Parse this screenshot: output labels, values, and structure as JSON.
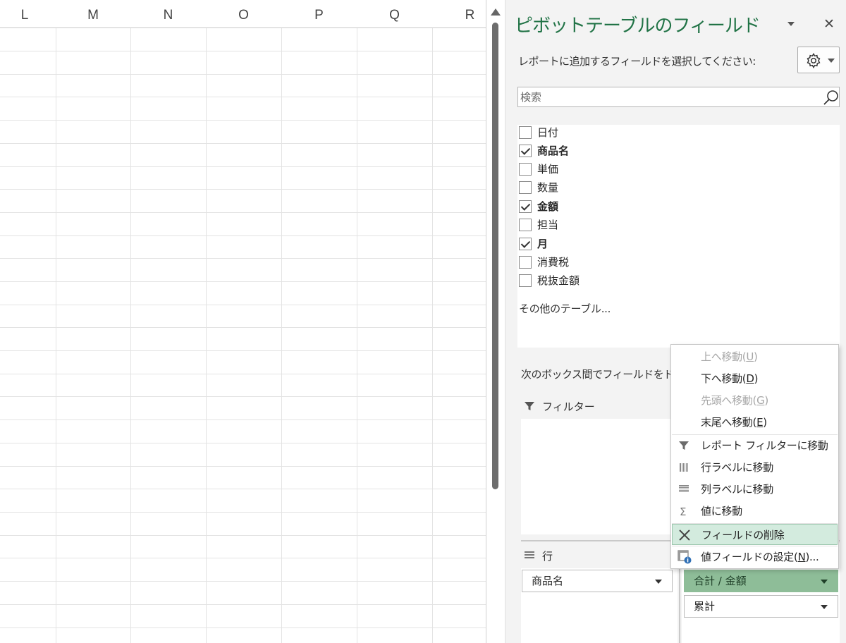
{
  "sheet": {
    "columns": [
      "L",
      "M",
      "N",
      "O",
      "P",
      "Q",
      "R"
    ]
  },
  "pane": {
    "title": "ピボットテーブルのフィールド",
    "instruction": "レポートに追加するフィールドを選択してください:",
    "search_placeholder": "検索",
    "fields": [
      {
        "label": "日付",
        "checked": false
      },
      {
        "label": "商品名",
        "checked": true
      },
      {
        "label": "単価",
        "checked": false
      },
      {
        "label": "数量",
        "checked": false
      },
      {
        "label": "金額",
        "checked": true
      },
      {
        "label": "担当",
        "checked": false
      },
      {
        "label": "月",
        "checked": true
      },
      {
        "label": "消費税",
        "checked": false
      },
      {
        "label": "税抜金額",
        "checked": false
      }
    ],
    "more_tables": "その他のテーブル...",
    "drag_instruction": "次のボックス間でフィールドをドラッ",
    "filter_label": "フィルター",
    "rows_label": "行",
    "rows_pills": [
      {
        "label": "商品名"
      }
    ],
    "values_pills": [
      {
        "label": "合計 / 金額"
      },
      {
        "label": "累計"
      }
    ]
  },
  "context_menu": {
    "items": [
      {
        "label": "上へ移動(",
        "key": "U",
        "suffix": ")",
        "disabled": true,
        "icon": ""
      },
      {
        "label": "下へ移動(",
        "key": "D",
        "suffix": ")",
        "disabled": false,
        "icon": ""
      },
      {
        "label": "先頭へ移動(",
        "key": "G",
        "suffix": ")",
        "disabled": true,
        "icon": ""
      },
      {
        "label": "末尾へ移動(",
        "key": "E",
        "suffix": ")",
        "disabled": false,
        "icon": ""
      },
      {
        "label": "レポート フィルターに移動",
        "key": "",
        "suffix": "",
        "disabled": false,
        "icon": "filter-icon"
      },
      {
        "label": "行ラベルに移動",
        "key": "",
        "suffix": "",
        "disabled": false,
        "icon": "row-labels-icon"
      },
      {
        "label": "列ラベルに移動",
        "key": "",
        "suffix": "",
        "disabled": false,
        "icon": "column-labels-icon"
      },
      {
        "label": "値に移動",
        "key": "",
        "suffix": "",
        "disabled": false,
        "icon": "sigma-icon"
      },
      {
        "label": "フィールドの削除",
        "key": "",
        "suffix": "",
        "disabled": false,
        "icon": "remove-x-icon",
        "highlighted": true
      },
      {
        "label": "値フィールドの設定(",
        "key": "N",
        "suffix": ")...",
        "disabled": false,
        "icon": "field-settings-icon"
      }
    ]
  },
  "colors": {
    "title_green": "#217346",
    "active_pill": "#8ebd98",
    "menu_highlight": "#d3ebde"
  }
}
